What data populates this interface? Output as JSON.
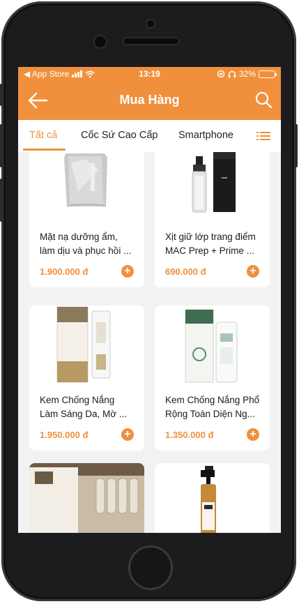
{
  "status_bar": {
    "carrier": "◀ App Store",
    "time": "13:19",
    "battery": "32%",
    "battery_level": 0.32
  },
  "nav": {
    "title": "Mua Hàng",
    "back_icon": "arrow-left-icon",
    "search_icon": "search-icon"
  },
  "tabs": {
    "items": [
      {
        "label": "Tất cả",
        "active": true
      },
      {
        "label": "Cốc Sứ Cao Cấp",
        "active": false
      },
      {
        "label": "Smartphone",
        "active": false
      }
    ],
    "menu_icon": "list-menu-icon"
  },
  "colors": {
    "accent": "#f0903d",
    "background": "#f2f2f3",
    "text": "#1a1a1a"
  },
  "products": [
    {
      "name": "Mặt nạ dưỡng ẩm,\nlàm dịu và phục hồi ...",
      "price": "1.900.000 đ"
    },
    {
      "name": "Xịt giữ lớp trang điểm\nMAC Prep + Prime ...",
      "price": "690.000 đ"
    },
    {
      "name": "Kem Chống Nắng\nLàm Sáng Da, Mờ ...",
      "price": "1.950.000 đ"
    },
    {
      "name": "Kem Chống Nắng Phổ\nRộng Toàn Diện Ng...",
      "price": "1.350.000 đ"
    },
    {
      "name": "",
      "price": "",
      "image_text": "MARTI DERM PIGMENT ZERO"
    },
    {
      "name": "",
      "price": "",
      "image_text": "GIGI"
    }
  ]
}
